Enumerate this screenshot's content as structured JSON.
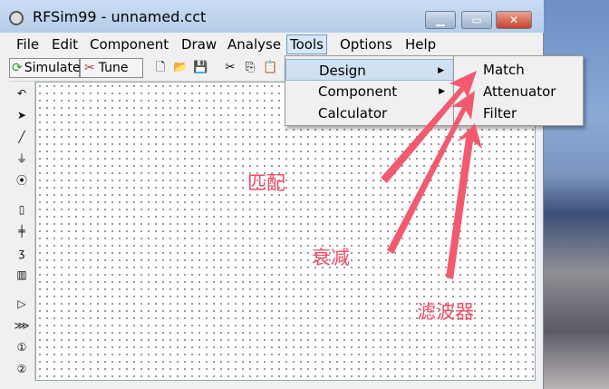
{
  "window": {
    "title": "RFSim99 - unnamed.cct"
  },
  "menubar": {
    "items": [
      "File",
      "Edit",
      "Component",
      "Draw",
      "Analyse",
      "Tools",
      "Options",
      "Help"
    ]
  },
  "toolbar": {
    "simulate_label": "Simulate",
    "tune_label": "Tune"
  },
  "tools_menu": {
    "items": [
      "Design",
      "Component",
      "Calculator"
    ]
  },
  "design_submenu": {
    "items": [
      "Match",
      "Attenuator",
      "Filter"
    ]
  },
  "annotations": {
    "match": "匹配",
    "attenuator": "衰减",
    "filter": "滤波器"
  },
  "colors": {
    "annotation": "#f04a63",
    "menu_highlight": "#cfe0f3",
    "close_button": "#c6432a"
  }
}
